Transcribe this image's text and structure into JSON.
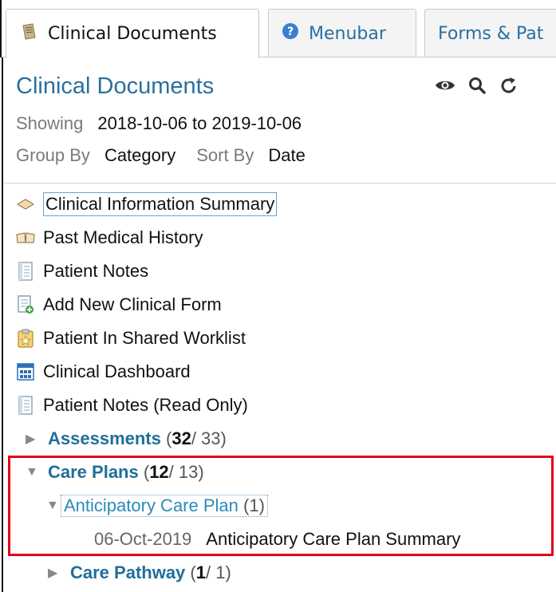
{
  "tabs": [
    {
      "label": "Clinical Documents",
      "icon": "document-icon"
    },
    {
      "label": "Menubar",
      "icon": "help-icon"
    },
    {
      "label": "Forms & Pat",
      "icon": ""
    }
  ],
  "header": {
    "title": "Clinical Documents",
    "showing_label": "Showing",
    "showing_value": "2018-10-06 to 2019-10-06",
    "group_label": "Group By",
    "group_value": "Category",
    "sort_label": "Sort By",
    "sort_value": "Date"
  },
  "tree": {
    "items": [
      {
        "label": "Clinical Information Summary",
        "icon": "summary-icon"
      },
      {
        "label": "Past Medical History",
        "icon": "book-icon"
      },
      {
        "label": "Patient Notes",
        "icon": "notes-icon"
      },
      {
        "label": "Add New Clinical Form",
        "icon": "add-form-icon"
      },
      {
        "label": "Patient In Shared Worklist",
        "icon": "worklist-icon"
      },
      {
        "label": "Clinical Dashboard",
        "icon": "dashboard-icon"
      },
      {
        "label": "Patient Notes (Read Only)",
        "icon": "notes-icon"
      }
    ],
    "categories": [
      {
        "label": "Assessments",
        "open": "(",
        "bold": "32",
        "rest": " / 33)"
      },
      {
        "label": "Care Plans",
        "open": "(",
        "bold": "12",
        "rest": " / 13)"
      },
      {
        "label": "Care Pathway",
        "open": "(",
        "bold": "1",
        "rest": " / 1)"
      }
    ],
    "sub": {
      "label": "Anticipatory Care Plan",
      "count": "(1)"
    },
    "doc": {
      "date": "06-Oct-2019",
      "title": "Anticipatory Care Plan Summary"
    }
  },
  "colors": {
    "link": "#2b6f9e",
    "highlight": "#e2001a"
  }
}
